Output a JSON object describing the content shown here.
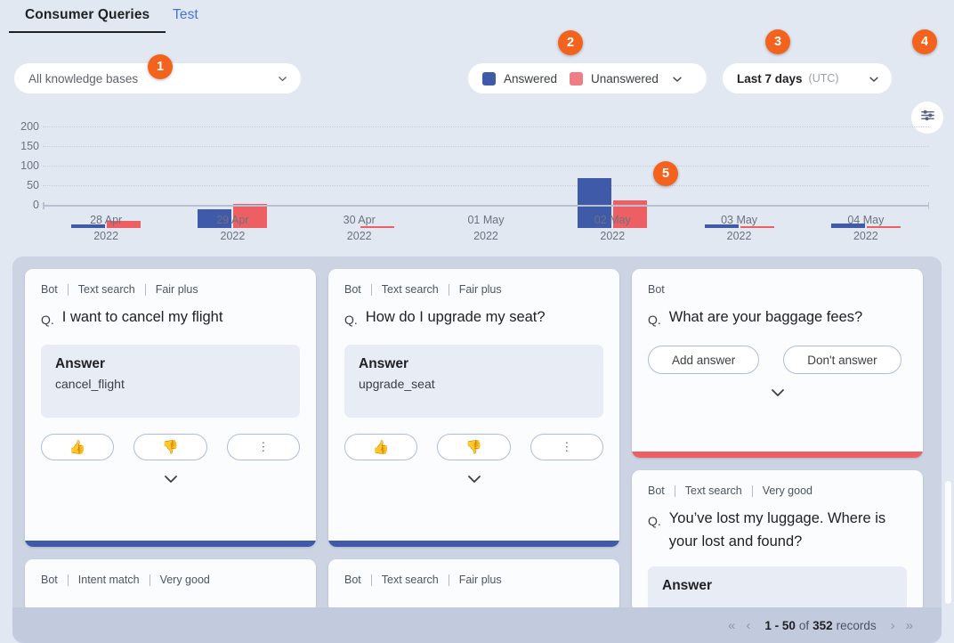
{
  "tabs": [
    {
      "label": "Consumer Queries",
      "active": true
    },
    {
      "label": "Test",
      "active": false
    }
  ],
  "filters": {
    "knowledge_base": {
      "value": "All knowledge bases"
    },
    "legend": {
      "answered_label": "Answered",
      "unanswered_label": "Unanswered",
      "answered_color": "#3f5aa9",
      "unanswered_color": "#ee5f64"
    },
    "date_range": {
      "value": "Last 7 days",
      "timezone": "(UTC)"
    },
    "settings_icon": "sliders-icon"
  },
  "badges": [
    {
      "n": "1"
    },
    {
      "n": "2"
    },
    {
      "n": "3"
    },
    {
      "n": "4"
    },
    {
      "n": "5"
    }
  ],
  "chart_data": {
    "type": "bar",
    "title": "",
    "xlabel": "",
    "ylabel": "",
    "ylim": [
      0,
      200
    ],
    "yticks": [
      200,
      150,
      100,
      50,
      0
    ],
    "grid": true,
    "legend_position": "top",
    "categories": [
      "28 Apr\n2022",
      "29 Apr\n2022",
      "30 Apr\n2022",
      "01 May\n2022",
      "02 May\n2022",
      "03 May\n2022",
      "04 May\n2022"
    ],
    "category_lines": [
      [
        "28 Apr",
        "2022"
      ],
      [
        "29 Apr",
        "2022"
      ],
      [
        "30 Apr",
        "2022"
      ],
      [
        "01 May",
        "2022"
      ],
      [
        "02 May",
        "2022"
      ],
      [
        "03 May",
        "2022"
      ],
      [
        "04 May",
        "2022"
      ]
    ],
    "series": [
      {
        "name": "Answered",
        "color": "#3f5aa9",
        "values": [
          8,
          48,
          0,
          0,
          128,
          9,
          11
        ]
      },
      {
        "name": "Unanswered",
        "color": "#ee5f64",
        "values": [
          18,
          62,
          2,
          0,
          70,
          4,
          3
        ]
      }
    ]
  },
  "cards": {
    "column1": [
      {
        "source": "Bot",
        "method": "Text search",
        "quality": "Fair plus",
        "q_prefix": "Q.",
        "question": "I want to cancel my flight",
        "answer_title": "Answer",
        "answer_body": "cancel_flight",
        "thumbs_up": "👍",
        "thumbs_down": "👎",
        "kebab": "⋮",
        "accent": "blue"
      },
      {
        "source": "Bot",
        "method": "Intent match",
        "quality": "Very good"
      }
    ],
    "column2": [
      {
        "source": "Bot",
        "method": "Text search",
        "quality": "Fair plus",
        "q_prefix": "Q.",
        "question": "How do I upgrade my seat?",
        "answer_title": "Answer",
        "answer_body": "upgrade_seat",
        "thumbs_up": "👍",
        "thumbs_down": "👎",
        "kebab": "⋮",
        "accent": "blue"
      },
      {
        "source": "Bot",
        "method": "Text search",
        "quality": "Fair plus"
      }
    ],
    "column3": [
      {
        "source": "Bot",
        "q_prefix": "Q.",
        "question": "What are your baggage fees?",
        "add_answer_label": "Add answer",
        "dont_answer_label": "Don't answer",
        "accent": "red"
      },
      {
        "source": "Bot",
        "method": "Text search",
        "quality": "Very good",
        "q_prefix": "Q.",
        "question": "You’ve lost my luggage. Where is your lost and found?",
        "answer_title": "Answer"
      }
    ]
  },
  "footer": {
    "first_icon": "«",
    "prev_icon": "‹",
    "range": "1 - 50",
    "of": "of",
    "total": "352",
    "records_word": "records",
    "next_icon": "›",
    "last_icon": "»"
  }
}
